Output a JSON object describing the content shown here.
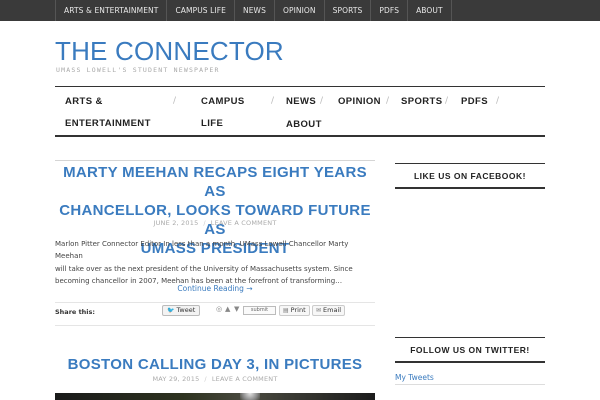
{
  "topnav": {
    "items": [
      "ARTS & ENTERTAINMENT",
      "CAMPUS LIFE",
      "NEWS",
      "OPINION",
      "SPORTS",
      "PDFS",
      "ABOUT"
    ]
  },
  "header": {
    "title": "THE CONNECTOR",
    "tagline": "UMASS LOWELL'S STUDENT NEWSPAPER"
  },
  "mainnav": {
    "arts_line1": "ARTS &",
    "arts_line2": "ENTERTAINMENT",
    "campus_line1": "CAMPUS",
    "campus_line2": "LIFE",
    "news": "NEWS",
    "opinion": "OPINION",
    "sports": "SPORTS",
    "pdfs": "PDFS",
    "about": "ABOUT",
    "separator": "/"
  },
  "posts": [
    {
      "title_line1": "MARTY MEEHAN RECAPS EIGHT YEARS AS",
      "title_line2": "CHANCELLOR, LOOKS TOWARD FUTURE AS",
      "title_line3": "UMASS PRESIDENT",
      "date": "JUNE 2, 2015",
      "comment_link": "LEAVE A COMMENT",
      "meta_separator": "/",
      "excerpt_line1": "Marlon Pitter Connector Editor In less than a month, UMass Lowell Chancellor Marty Meehan",
      "excerpt_line2": "will take over as the next president of the University of Massachusetts system. Since",
      "excerpt_line3": "becoming chancellor in 2007, Meehan has been at the forefront of transforming…",
      "continue": "Continue Reading →",
      "share_label": "Share this:",
      "tweet": "Tweet",
      "submit": "submit",
      "print": "Print",
      "email": "Email"
    },
    {
      "title_line1": "BOSTON CALLING DAY 3, IN PICTURES",
      "date": "MAY 29, 2015",
      "comment_link": "LEAVE A COMMENT",
      "meta_separator": "/"
    }
  ],
  "sidebar": {
    "facebook_title": "LIKE US ON FACEBOOK!",
    "twitter_title": "FOLLOW US ON TWITTER!",
    "twitter_link": "My Tweets"
  },
  "icons": {
    "twitter": "twitter-bird-icon",
    "stumbleupon": "stumbleupon-icon",
    "vote_up": "thumb-up-icon",
    "vote_down": "thumb-down-icon",
    "print": "printer-icon",
    "email": "envelope-icon"
  },
  "colors": {
    "accent": "#3a7bbf",
    "topbar": "#3a3a3a"
  }
}
